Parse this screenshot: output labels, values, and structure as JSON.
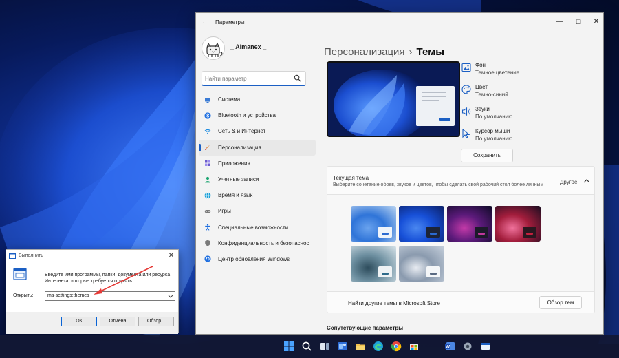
{
  "settings": {
    "window_title": "Параметры",
    "controls": {
      "minimize": "—",
      "maximize": "☐",
      "close": "✕"
    },
    "user_name": "_ Almanex _",
    "search_placeholder": "Найти параметр",
    "nav": [
      {
        "label": "Система",
        "icon": "monitor-icon",
        "color": "#3a7bd5"
      },
      {
        "label": "Bluetooth и устройства",
        "icon": "bluetooth-icon",
        "color": "#1f6fe0"
      },
      {
        "label": "Сеть & и Интернет",
        "icon": "wifi-icon",
        "color": "#1e8ce0"
      },
      {
        "label": "Персонализация",
        "icon": "brush-icon",
        "color": "#e07a2f",
        "active": true
      },
      {
        "label": "Приложения",
        "icon": "apps-icon",
        "color": "#6a5acd"
      },
      {
        "label": "Учетные записи",
        "icon": "person-icon",
        "color": "#1ea672"
      },
      {
        "label": "Время и язык",
        "icon": "globe-icon",
        "color": "#1aa0d8"
      },
      {
        "label": "Игры",
        "icon": "gamepad-icon",
        "color": "#7a7a7a"
      },
      {
        "label": "Специальные возможности",
        "icon": "accessibility-icon",
        "color": "#1f6fe0"
      },
      {
        "label": "Конфиденциальность и безопаснос",
        "icon": "shield-icon",
        "color": "#7a7a7a"
      },
      {
        "label": "Центр обновления Windows",
        "icon": "update-icon",
        "color": "#1f6fe0"
      }
    ],
    "breadcrumb": {
      "parent": "Персонализация",
      "separator": "›",
      "current": "Темы"
    },
    "properties": [
      {
        "name": "Фон",
        "value": "Темное цветение",
        "icon": "image-icon"
      },
      {
        "name": "Цвет",
        "value": "Темно-синий",
        "icon": "palette-icon"
      },
      {
        "name": "Звуки",
        "value": "По умолчанию",
        "icon": "sound-icon"
      },
      {
        "name": "Курсор мыши",
        "value": "По умолчанию",
        "icon": "cursor-icon"
      }
    ],
    "save_label": "Сохранить",
    "current_theme": {
      "title": "Текущая тема",
      "subtitle": "Выберите сочетание обоев, звуков и цветов, чтобы сделать свой рабочий стол более личным",
      "status": "Другое"
    },
    "themes": [
      {
        "name": "windows-light",
        "colors": [
          "#bcd6f2",
          "#2f74d8",
          "#6aa3ee"
        ],
        "window": "#eef3fa",
        "bar": "#2b6ad0"
      },
      {
        "name": "windows-dark",
        "colors": [
          "#0b1f66",
          "#1750d8",
          "#4a87f0"
        ],
        "window": "#1c2438",
        "bar": "#2b6ad0"
      },
      {
        "name": "glow",
        "colors": [
          "#0c0a24",
          "#5b1a7a",
          "#c33aa8"
        ],
        "window": "#1c1a2a",
        "bar": "#c0389c"
      },
      {
        "name": "captured-motion",
        "colors": [
          "#1a0d20",
          "#a31d3c",
          "#f0729c"
        ],
        "window": "#2a1820",
        "bar": "#c5203e"
      },
      {
        "name": "sunrise",
        "colors": [
          "#d8e4ea",
          "#6d8fa0",
          "#2d4c5c"
        ],
        "window": "#eef2f4",
        "bar": "#2e6a8a"
      },
      {
        "name": "flow",
        "colors": [
          "#c6d0dc",
          "#8a9aae",
          "#e8ecf2"
        ],
        "window": "#f4f6f8",
        "bar": "#5a6a82"
      }
    ],
    "store_text": "Найти другие темы в Microsoft Store",
    "browse_label": "Обзор тем",
    "related_heading": "Сопутствующие параметры"
  },
  "run_dialog": {
    "title": "Выполнить",
    "close": "✕",
    "description": "Введите имя программы, папки, документа или ресурса Интернета, которые требуется открыть.",
    "open_label": "Открыть:",
    "input_value": "ms-settings:themes",
    "ok_label": "ОК",
    "cancel_label": "Отмена",
    "browse_label": "Обзор..."
  },
  "taskbar": {
    "icons": [
      "windows-start-icon",
      "search-icon",
      "task-view-icon",
      "widgets-icon",
      "file-explorer-icon",
      "edge-icon",
      "chrome-icon",
      "store-icon",
      "word-icon",
      "settings-icon",
      "run-icon"
    ]
  },
  "colors": {
    "accent": "#1b5fc4",
    "arrow": "#e53935"
  }
}
